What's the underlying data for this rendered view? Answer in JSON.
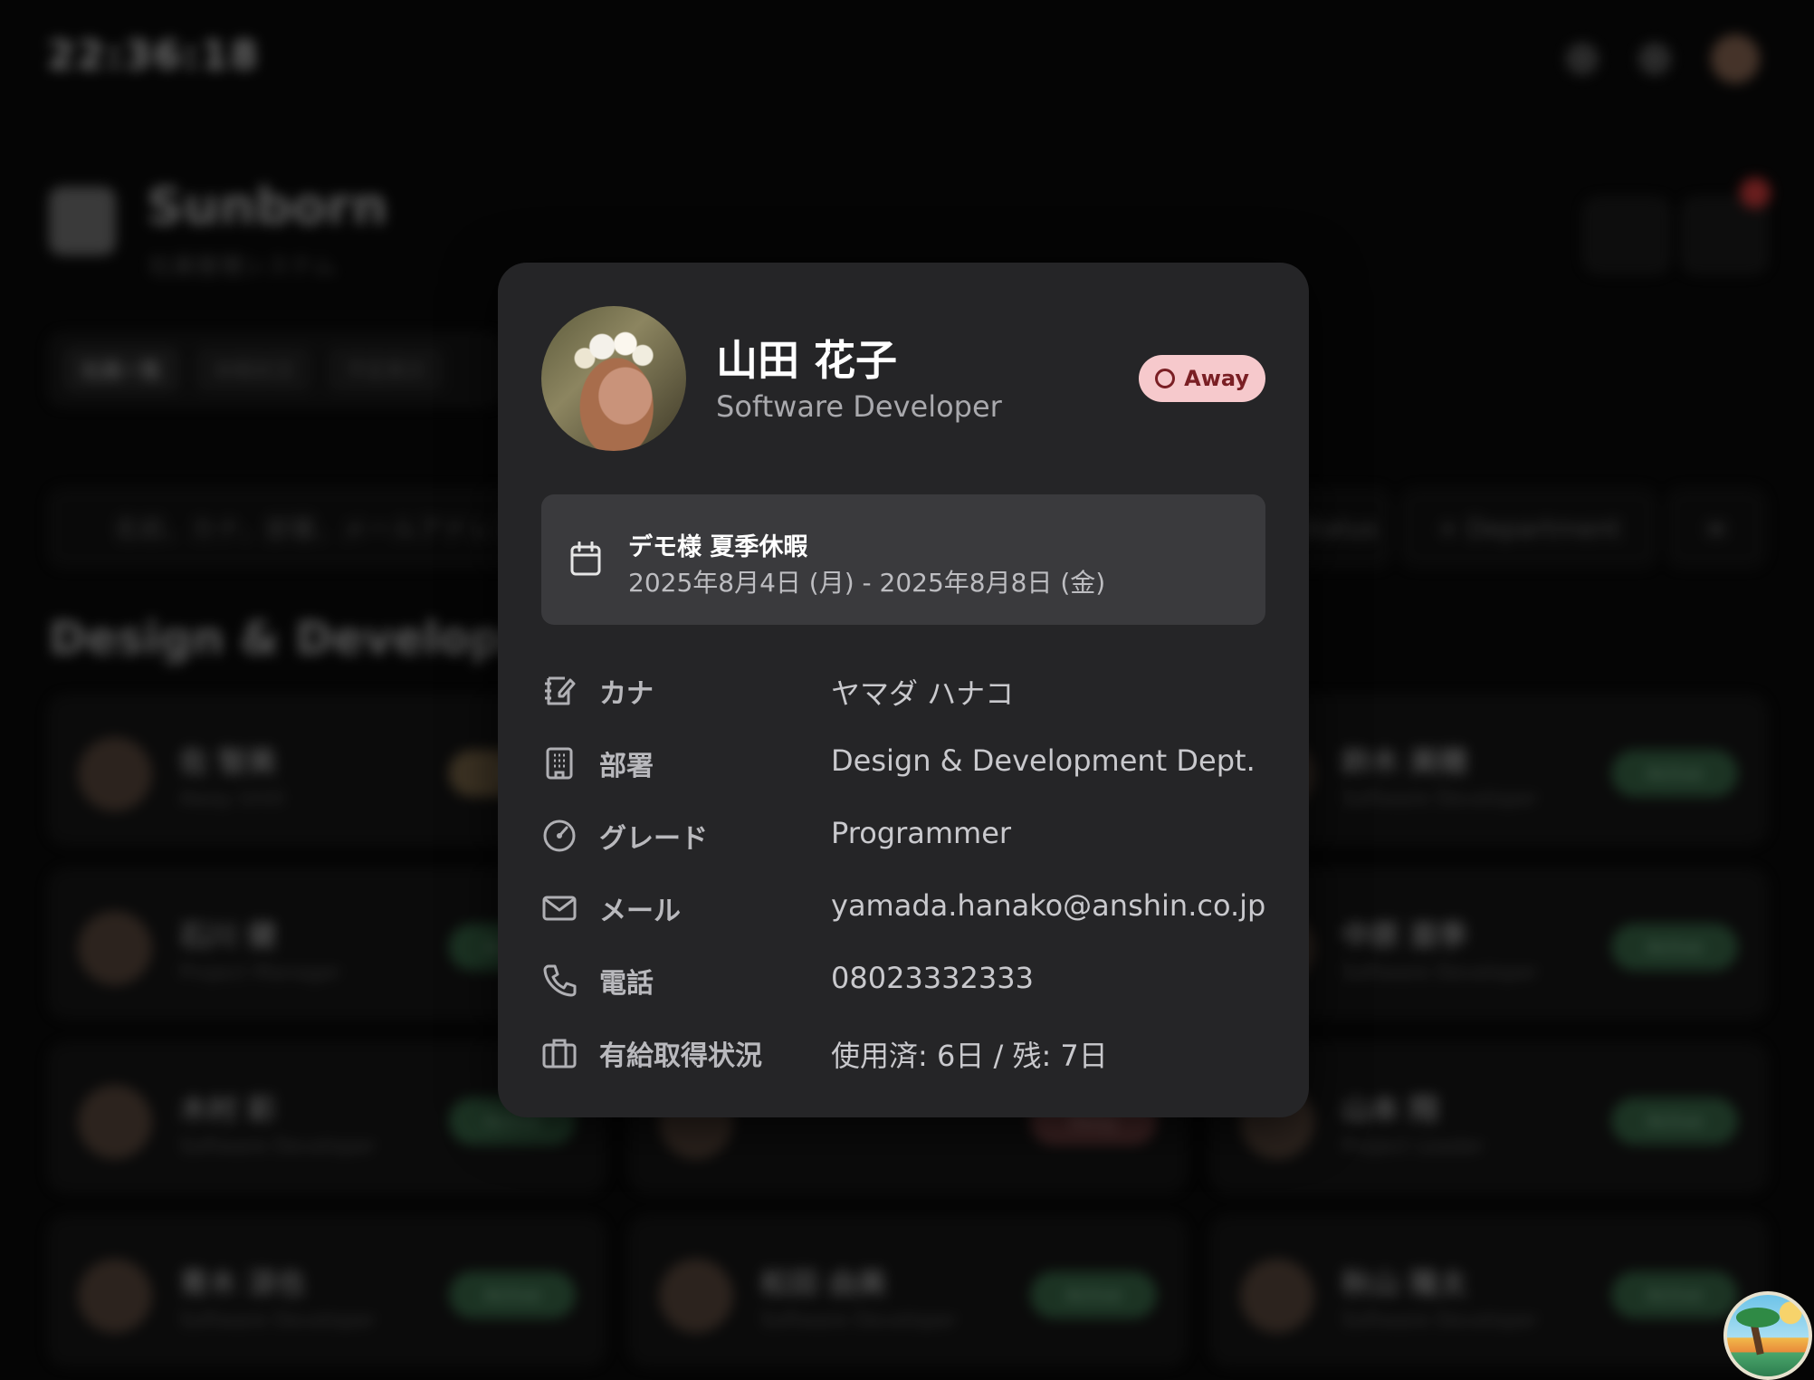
{
  "background": {
    "clock": "22:36:18",
    "brand": "Sunborn",
    "brand_sub": "社員管理システム",
    "tabs": [
      "社員一覧",
      "休暇状況",
      "予定表示"
    ],
    "search_placeholder": "名前、カナ、部署、メールアドレスで検索",
    "filters": [
      "Status",
      "+ Department",
      "≡"
    ],
    "section_title": "Design & Development",
    "cards": [
      {
        "name": "佐 智美",
        "role": "Away Until",
        "status": "Off"
      },
      {
        "name": "鈴木 美穂",
        "role": "Software Developer",
        "status": "Active"
      },
      {
        "name": "石川 健",
        "role": "Project Manager",
        "status": "Active"
      },
      {
        "name": "中原 亜季",
        "role": "Software Developer",
        "status": "Active"
      },
      {
        "name": "木村 彩",
        "role": "Software Developer",
        "status": "Active"
      },
      {
        "name": "",
        "role": "",
        "status": "Away"
      },
      {
        "name": "山本 翔",
        "role": "Project Leader",
        "status": "Active"
      },
      {
        "name": "青木 涼也",
        "role": "Software Developer",
        "status": "Active"
      },
      {
        "name": "松田 由美",
        "role": "Software Developer",
        "status": "Active"
      },
      {
        "name": "秋山 隆太",
        "role": "Software Developer",
        "status": "Active"
      }
    ]
  },
  "profile": {
    "name": "山田 花子",
    "role": "Software Developer",
    "status": "Away",
    "vacation": {
      "title": "デモ様 夏季休暇",
      "dates": "2025年8月4日 (月) - 2025年8月8日 (金)"
    },
    "rows": [
      {
        "icon": "note-edit-icon",
        "label": "カナ",
        "value": "ヤマダ ハナコ"
      },
      {
        "icon": "building-icon",
        "label": "部署",
        "value": "Design & Development Dept."
      },
      {
        "icon": "gauge-icon",
        "label": "グレード",
        "value": "Programmer"
      },
      {
        "icon": "mail-icon",
        "label": "メール",
        "value": "yamada.hanako@anshin.co.jp"
      },
      {
        "icon": "phone-icon",
        "label": "電話",
        "value": "08023332333"
      },
      {
        "icon": "briefcase-icon",
        "label": "有給取得状況",
        "value": "使用済: 6日 / 残: 7日"
      }
    ]
  },
  "colors": {
    "modal_bg": "#252527",
    "badge_bg": "#f6c9cc",
    "badge_text": "#7a1f24",
    "vacation_bg": "#3a3a3d"
  }
}
